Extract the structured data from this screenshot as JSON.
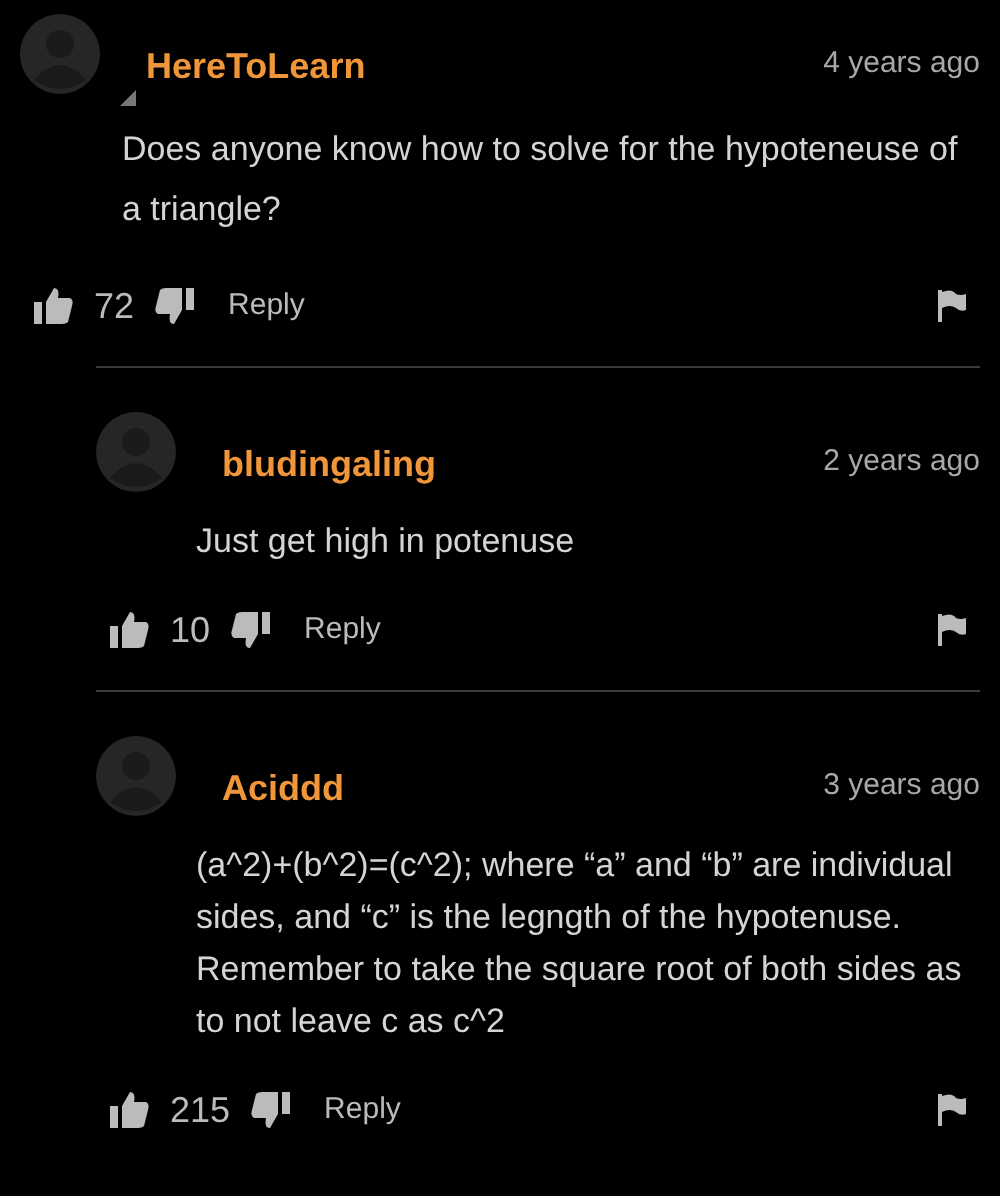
{
  "comments": [
    {
      "author": "HereToLearn",
      "time": "4 years ago",
      "text": "Does anyone know how to solve for the hypoteneuse of a triangle?",
      "likes": "72",
      "reply": "Reply",
      "replies": [
        {
          "author": "bludingaling",
          "time": "2 years ago",
          "text": "Just get high in potenuse",
          "likes": "10",
          "reply": "Reply"
        },
        {
          "author": "Aciddd",
          "time": "3 years ago",
          "text": "(a^2)+(b^2)=(c^2); where “a” and “b” are individual sides, and “c” is the legngth of the hypotenuse. Remember to take the square root of both sides as to not leave c as c^2",
          "likes": "215",
          "reply": "Reply"
        }
      ]
    }
  ]
}
